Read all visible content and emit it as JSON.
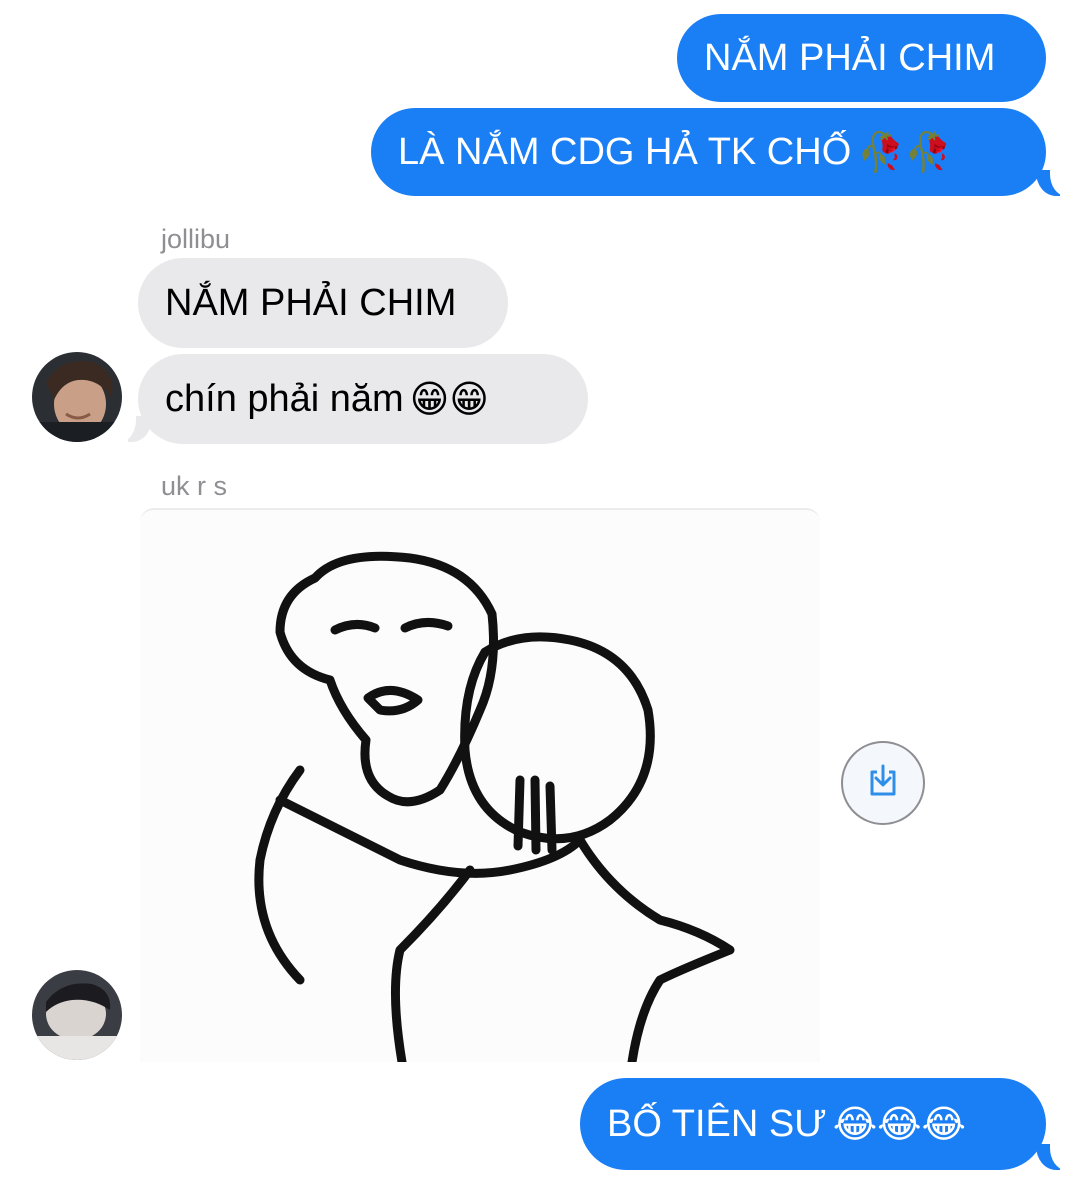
{
  "messages": {
    "m1": "NẮM PHẢI CHIM",
    "m2": "LÀ NẮM CDG HẢ TK CHỐ",
    "m2_emoji": "🥀🥀",
    "sender1": "jollibu",
    "m3": "NẮM PHẢI CHIM",
    "m4": "chín phải năm",
    "m4_emoji": "😁😁",
    "sender2": "uk r s",
    "m5": "BỐ TIÊN SƯ",
    "m5_emoji": "😂😂😂"
  },
  "icons": {
    "download": "download-icon",
    "meme": "stick-figure-hug-meme"
  },
  "colors": {
    "outgoing": "#1a7ef5",
    "incoming": "#e9e9eb",
    "sender_label": "#8e8e93",
    "download_icon": "#2f8fe8"
  }
}
